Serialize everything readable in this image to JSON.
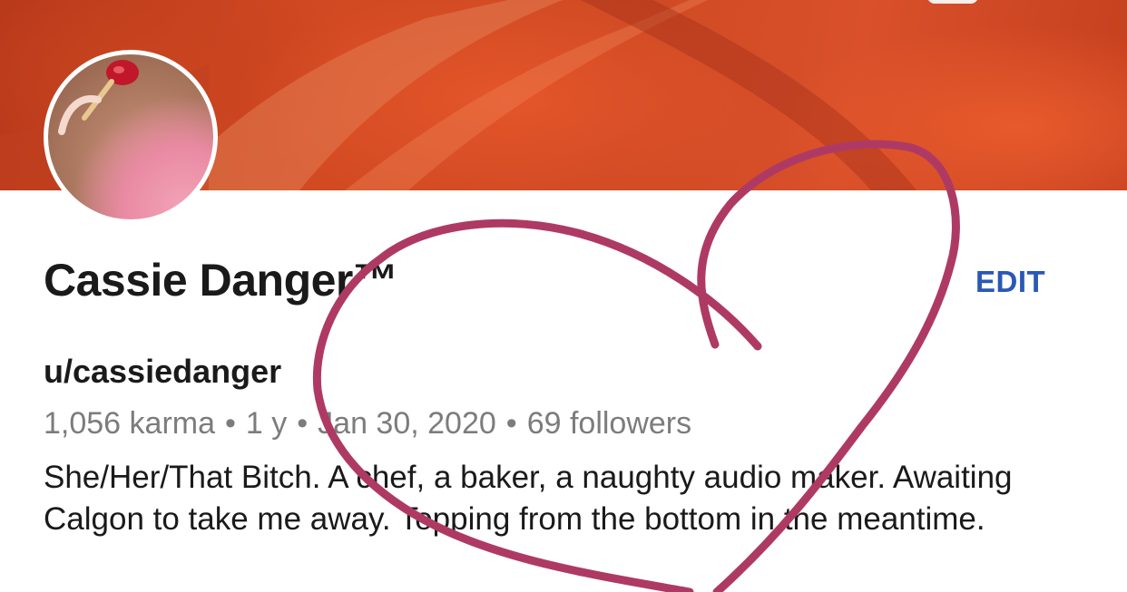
{
  "profile": {
    "display_name": "Cassie Danger™",
    "username": "u/cassiedanger",
    "karma": "1,056 karma",
    "age": "1 y",
    "joined": "Jan 30, 2020",
    "followers": "69 followers",
    "separator": "•",
    "bio": "She/Her/That Bitch. A chef, a baker, a naughty audio maker. Awaiting Calgon to take me away. Topping from the bottom in the meantime."
  },
  "actions": {
    "edit_label": "EDIT"
  },
  "colors": {
    "accent": "#2a58b5",
    "banner": "#d24a22",
    "heart_stroke": "#ae3a64",
    "muted_text": "#7c7c7c"
  },
  "icons": {
    "overlay": "heart-doodle"
  }
}
